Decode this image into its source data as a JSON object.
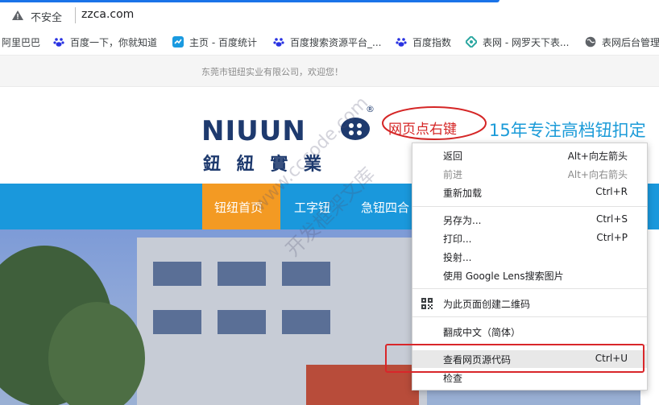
{
  "browser": {
    "security_label": "不安全",
    "url": "zzca.com"
  },
  "bookmarks": [
    {
      "label": "阿里巴巴",
      "icon": "none"
    },
    {
      "label": "百度一下，你就知道",
      "icon": "baidu-paw-icon"
    },
    {
      "label": "主页 - 百度统计",
      "icon": "baidu-tongji-icon"
    },
    {
      "label": "百度搜索资源平台_...",
      "icon": "baidu-paw-icon"
    },
    {
      "label": "百度指数",
      "icon": "baidu-paw-icon"
    },
    {
      "label": "表网 - 网罗天下表...",
      "icon": "biaowang-icon"
    },
    {
      "label": "表网后台管理",
      "icon": "globe-icon"
    }
  ],
  "site": {
    "welcome": "东莞市钮纽实业有限公司，欢迎您！",
    "logo_latin": "NIUUN",
    "logo_cn": "鈕 紐 實 業",
    "registered": "®",
    "slogan": "15年专注高档钮扣定",
    "annotation": "网页点右键",
    "nav": [
      "钮纽首页",
      "工字钮",
      "急钮四合"
    ],
    "watermark_1": "www.cccode.com",
    "watermark_2": "开发框架文库"
  },
  "context_menu": {
    "items": [
      {
        "label": "返回",
        "shortcut": "Alt+向左箭头",
        "disabled": false
      },
      {
        "label": "前进",
        "shortcut": "Alt+向右箭头",
        "disabled": true
      },
      {
        "label": "重新加载",
        "shortcut": "Ctrl+R",
        "disabled": false
      },
      {
        "label": "另存为...",
        "shortcut": "Ctrl+S",
        "disabled": false
      },
      {
        "label": "打印...",
        "shortcut": "Ctrl+P",
        "disabled": false
      },
      {
        "label": "投射...",
        "shortcut": "",
        "disabled": false
      },
      {
        "label": "使用 Google Lens搜索图片",
        "shortcut": "",
        "disabled": false
      },
      {
        "label": "为此页面创建二维码",
        "shortcut": "",
        "disabled": false,
        "icon": "qr-code-icon"
      },
      {
        "label": "翻成中文（简体）",
        "shortcut": "",
        "disabled": false
      },
      {
        "label": "查看网页源代码",
        "shortcut": "Ctrl+U",
        "disabled": false,
        "highlighted": true
      },
      {
        "label": "检查",
        "shortcut": "",
        "disabled": false
      }
    ]
  },
  "colors": {
    "nav_blue": "#1a98dc",
    "nav_active": "#f39a23",
    "annotation_red": "#d52626",
    "logo_navy": "#1e3a6e"
  }
}
